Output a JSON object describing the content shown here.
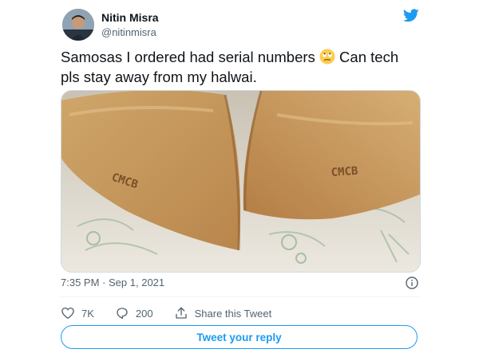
{
  "author": {
    "display_name": "Nitin Misra",
    "handle": "@nitinmisra",
    "avatar_icon": "avatar-photo"
  },
  "tweet": {
    "text_part1": "Samosas I ordered had serial numbers ",
    "emoji": "rolling-eyes-face",
    "text_part2": " Can tech pls stay away from my halwai.",
    "photo_embossed_text_left": "CMCB",
    "photo_embossed_text_right": "CMCB"
  },
  "meta": {
    "time": "7:35 PM",
    "separator": "·",
    "date": "Sep 1, 2021"
  },
  "actions": {
    "likes_count": "7K",
    "replies_count": "200",
    "share_label": "Share this Tweet"
  },
  "reply_button_label": "Tweet your reply",
  "colors": {
    "brand_blue": "#1d9bf0",
    "text_primary": "#0f1419",
    "text_secondary": "#536471",
    "divider": "#eff3f4"
  }
}
